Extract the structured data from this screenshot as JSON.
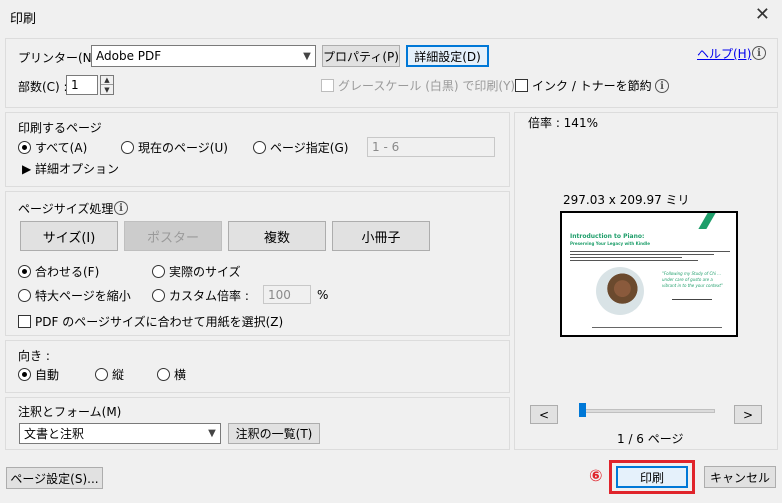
{
  "window": {
    "title": "印刷",
    "close_glyph": "✕"
  },
  "printer": {
    "label": "プリンター(N) :",
    "selected": "Adobe PDF",
    "properties_button": "プロパティ(P)",
    "advanced_button": "詳細設定(D)",
    "help_link": "ヘルプ(H)"
  },
  "copies": {
    "label": "部数(C) :",
    "value": "1"
  },
  "grayscale": {
    "label": "グレースケール (白黒) で印刷(Y)",
    "checked": false,
    "disabled": true
  },
  "save_ink": {
    "label": "インク / トナーを節約",
    "checked": false
  },
  "pages_section": {
    "title": "印刷するページ",
    "all": "すべて(A)",
    "current": "現在のページ(U)",
    "specify": "ページ指定(G)",
    "range_placeholder": "1 - 6",
    "more_options": "詳細オプション",
    "selected": "all"
  },
  "page_size_section": {
    "title": "ページサイズ処理",
    "buttons": [
      "サイズ(I)",
      "ポスター",
      "複数",
      "小冊子"
    ],
    "active_button": "サイズ(I)",
    "fit": "合わせる(F)",
    "actual": "実際のサイズ",
    "shrink": "特大ページを縮小",
    "custom_scale": "カスタム倍率 :",
    "custom_scale_value": "100",
    "custom_scale_unit": "%",
    "choose_paper": "PDF のページサイズに合わせて用紙を選択(Z)",
    "selected": "fit"
  },
  "orientation_section": {
    "title": "向き :",
    "auto": "自動",
    "portrait": "縦",
    "landscape": "横",
    "selected": "auto"
  },
  "comments_section": {
    "title": "注釈とフォーム(M)",
    "selected": "文書と注釈",
    "summary_button": "注釈の一覧(T)"
  },
  "preview": {
    "zoom": "倍率 : 141%",
    "dimensions": "297.03 x 209.97 ミリ",
    "prev_button": "<",
    "next_button": ">",
    "page_indicator": "1 / 6 ページ",
    "slider_position": 0.0,
    "page_content": {
      "heading": "Introduction to Piano:",
      "subheading": "Preserving Your Legacy with Kindle",
      "quote": "\"Following my Study of Chi ... under care of gusto are a vibrant in to the your context\""
    }
  },
  "footer": {
    "page_setup_button": "ページ設定(S)...",
    "step_marker": "⑥",
    "print_button": "印刷",
    "cancel_button": "キャンセル"
  },
  "colors": {
    "accent": "#0078d7",
    "highlight": "#e0242b",
    "preview_green": "#1e9e6a"
  }
}
